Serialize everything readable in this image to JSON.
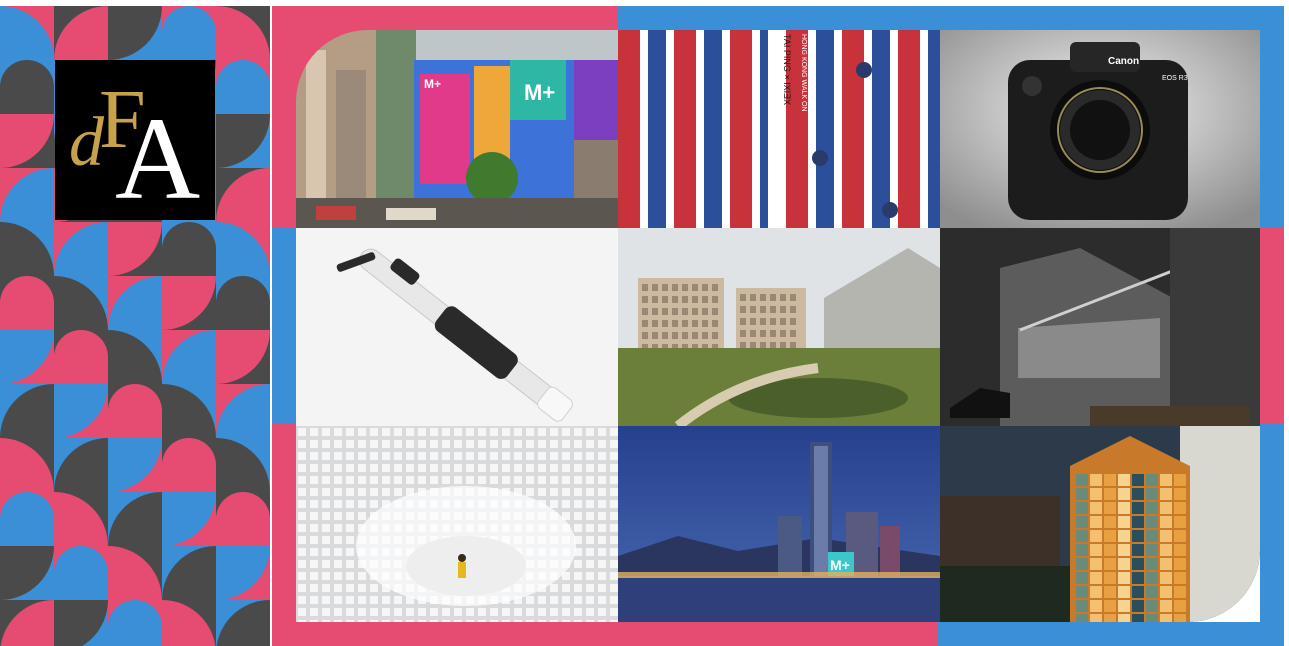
{
  "logo": {
    "letter_d": "d",
    "letter_f": "F",
    "letter_a": "A"
  },
  "colors": {
    "pink": "#e64b72",
    "blue": "#3a8fd6",
    "dark": "#4a4a4a",
    "gold": "#c8a24a"
  },
  "tiles": [
    {
      "icon": "mplus-billboard-street-photo",
      "sign_text": "M+",
      "sign_text_2": "M+"
    },
    {
      "icon": "striped-fabric-walkway-photo",
      "fabric_text": "TAI PING × IXIƎX",
      "fabric_text_2": "HONG KONG WALK ON"
    },
    {
      "icon": "canon-camera-photo",
      "brand": "Canon",
      "model": "EOS R3"
    },
    {
      "icon": "white-wind-instrument-photo"
    },
    {
      "icon": "modern-campus-buildings-photo"
    },
    {
      "icon": "concrete-hall-piano-photo"
    },
    {
      "icon": "white-lattice-tunnel-photo"
    },
    {
      "icon": "hong-kong-skyline-night-photo",
      "sign_text": "M+"
    },
    {
      "icon": "lit-glass-house-night-photo"
    }
  ]
}
